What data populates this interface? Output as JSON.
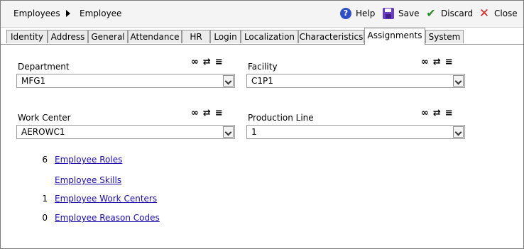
{
  "breadcrumb": {
    "root": "Employees",
    "current": "Employee"
  },
  "toolbar": {
    "help": "Help",
    "save": "Save",
    "discard": "Discard",
    "close": "Close"
  },
  "tabs": [
    "Identity",
    "Address",
    "General",
    "Attendance",
    "HR",
    "Login",
    "Localization",
    "Characteristics",
    "Assignments",
    "System"
  ],
  "active_tab": "Assignments",
  "fields": {
    "department": {
      "label": "Department",
      "value": "MFG1"
    },
    "facility": {
      "label": "Facility",
      "value": "C1P1"
    },
    "work_center": {
      "label": "Work Center",
      "value": "AEROWC1"
    },
    "production_line": {
      "label": "Production Line",
      "value": "1"
    }
  },
  "field_icons": {
    "link": "link-icon",
    "unlink": "unlink-icon",
    "menu": "menu-icon"
  },
  "links": [
    {
      "count": "6",
      "label": "Employee Roles"
    },
    {
      "count": "",
      "label": "Employee Skills"
    },
    {
      "count": "1",
      "label": "Employee Work Centers"
    },
    {
      "count": "0",
      "label": "Employee Reason Codes"
    }
  ],
  "colors": {
    "link": "#1a0dab",
    "help_icon": "#2f4fc7",
    "save_icon": "#6a3bc4",
    "discard_icon": "#2b8a2b",
    "close_icon": "#d62222"
  }
}
